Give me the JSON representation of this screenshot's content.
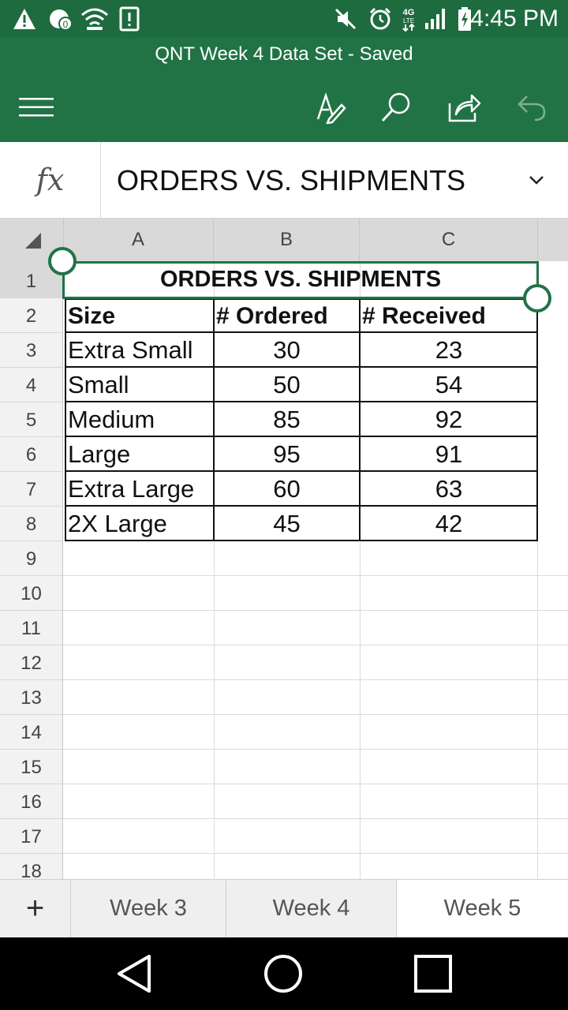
{
  "status_bar": {
    "time": "4:45 PM",
    "icons": [
      "warning-icon",
      "notification-app-icon",
      "wifi-icon",
      "sim-alert-icon",
      "mute-icon",
      "alarm-icon",
      "lte-icon",
      "signal-icon",
      "battery-charging-icon"
    ],
    "network_label": "4G LTE"
  },
  "app": {
    "document_title": "QNT Week 4 Data Set - Saved",
    "accent_color": "#217346",
    "toolbar_icons": [
      "menu-icon",
      "edit-pen-icon",
      "search-icon",
      "share-icon",
      "undo-icon"
    ]
  },
  "formula_bar": {
    "fx_label": "fx",
    "content": "ORDERS VS. SHIPMENTS"
  },
  "sheet": {
    "columns": [
      "A",
      "B",
      "C"
    ],
    "rows": [
      "1",
      "2",
      "3",
      "4",
      "5",
      "6",
      "7",
      "8",
      "9",
      "10",
      "11",
      "12",
      "13",
      "14",
      "15",
      "16",
      "17",
      "18"
    ],
    "title": "ORDERS VS. SHIPMENTS",
    "headers": [
      "Size",
      "# Ordered",
      "# Received"
    ],
    "data": [
      [
        "Extra Small",
        "30",
        "23"
      ],
      [
        "Small",
        "50",
        "54"
      ],
      [
        "Medium",
        "85",
        "92"
      ],
      [
        "Large",
        "95",
        "91"
      ],
      [
        "Extra Large",
        "60",
        "63"
      ],
      [
        "2X Large",
        "45",
        "42"
      ]
    ]
  },
  "tabs": {
    "add_label": "+",
    "items": [
      "Week 3",
      "Week 4",
      "Week 5"
    ],
    "active": "Week 5"
  },
  "nav_icons": [
    "back-icon",
    "home-icon",
    "recents-icon"
  ]
}
